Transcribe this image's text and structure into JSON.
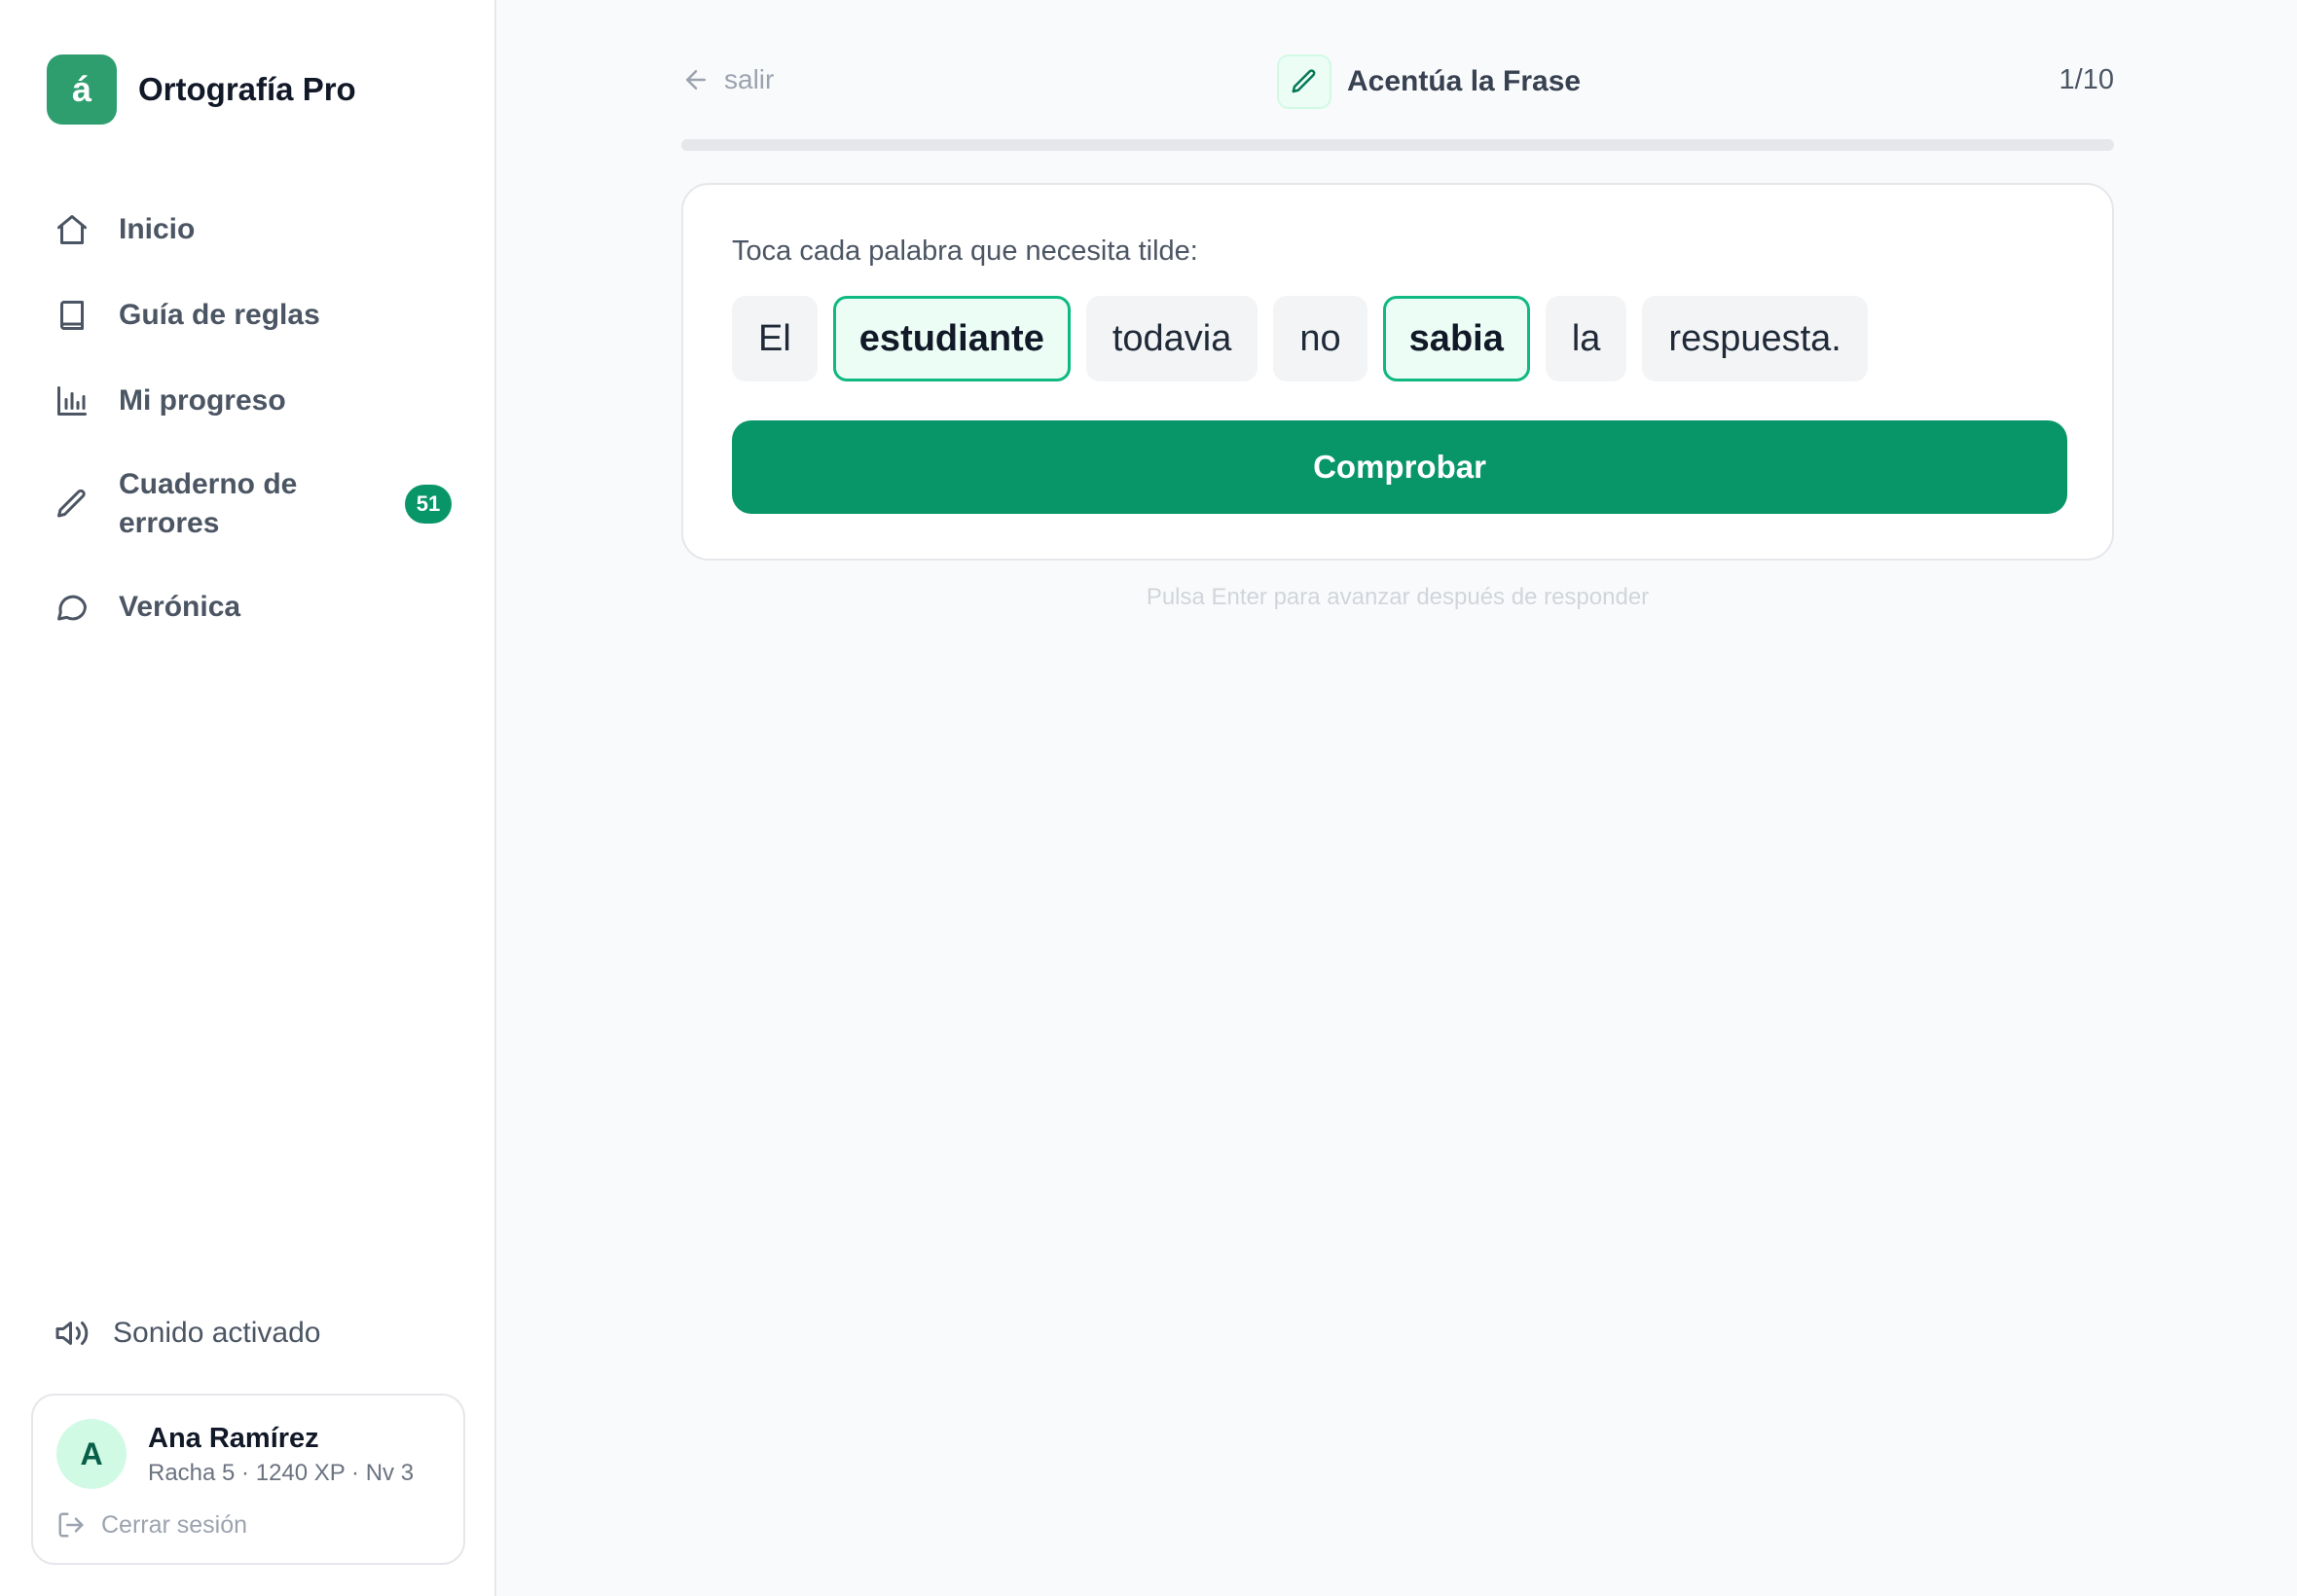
{
  "brand": {
    "logo_letter": "á",
    "name": "Ortografía Pro",
    "color": "#2e9e6f"
  },
  "nav": {
    "items": [
      {
        "label": "Inicio",
        "icon": "home-icon"
      },
      {
        "label": "Guía de reglas",
        "icon": "book-icon"
      },
      {
        "label": "Mi progreso",
        "icon": "bar-chart-icon"
      },
      {
        "label": "Cuaderno de errores",
        "icon": "pencil-icon",
        "badge": "51"
      },
      {
        "label": "Verónica",
        "icon": "chat-bubble-icon"
      }
    ]
  },
  "sound": {
    "label": "Sonido activado",
    "icon": "speaker-icon"
  },
  "user": {
    "initial": "A",
    "name": "Ana Ramírez",
    "stats": "Racha 5 · 1240 XP · Nv 3",
    "logout_label": "Cerrar sesión"
  },
  "header": {
    "exit_label": "salir",
    "title": "Acentúa la Frase",
    "counter": "1/10",
    "progress_fraction": 0
  },
  "exercise": {
    "instruction": "Toca cada palabra que necesita tilde:",
    "words": [
      {
        "text": "El",
        "selected": false
      },
      {
        "text": "estudiante",
        "selected": true
      },
      {
        "text": "todavia",
        "selected": false
      },
      {
        "text": "no",
        "selected": false
      },
      {
        "text": "sabia",
        "selected": true
      },
      {
        "text": "la",
        "selected": false
      },
      {
        "text": "respuesta.",
        "selected": false
      }
    ],
    "check_label": "Comprobar"
  },
  "hint": "Pulsa Enter para avanzar después de responder",
  "colors": {
    "accent": "#089669",
    "selected_border": "#10b981",
    "selected_bg": "#ecfdf5"
  }
}
